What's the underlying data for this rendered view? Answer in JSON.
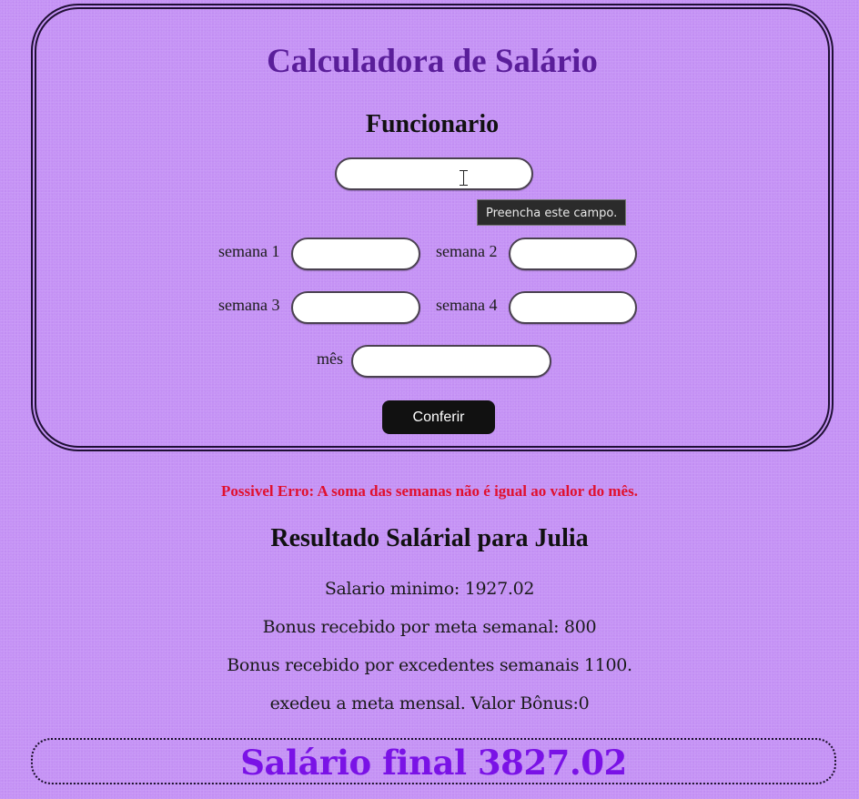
{
  "form": {
    "title": "Calculadora de Salário",
    "subtitle": "Funcionario",
    "name_field": {
      "value": ""
    },
    "tooltip": "Preencha este campo.",
    "fields": {
      "semana1_label": "semana 1",
      "semana2_label": "semana 2",
      "semana3_label": "semana 3",
      "semana4_label": "semana 4",
      "mes_label": "mês"
    },
    "submit_label": "Conferir"
  },
  "results": {
    "error": "Possivel Erro: A soma das semanas não é igual ao valor do mês.",
    "title": "Resultado Salárial para Julia",
    "lines": [
      "Salario minimo: 1927.02",
      "Bonus recebido por meta semanal: 800",
      "Bonus recebido por excedentes semanais 1100.",
      "exedeu a meta mensal. Valor Bônus:0"
    ],
    "final": "Salário final 3827.02"
  },
  "colors": {
    "background": "#c592f5",
    "title": "#5a1e9a",
    "error": "#e0102e",
    "final": "#7a12e6",
    "button": "#111111"
  }
}
